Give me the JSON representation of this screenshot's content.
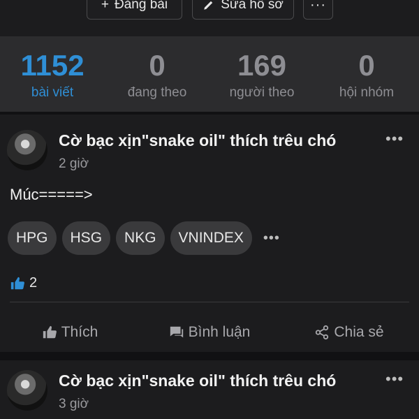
{
  "toolbar": {
    "post_label": "Đăng bài",
    "edit_profile_label": "Sửa hồ sơ",
    "more_label": "···"
  },
  "stats": [
    {
      "value": "1152",
      "label": "bài viết",
      "active": true
    },
    {
      "value": "0",
      "label": "đang theo",
      "active": false
    },
    {
      "value": "169",
      "label": "người theo",
      "active": false
    },
    {
      "value": "0",
      "label": "hội nhóm",
      "active": false
    }
  ],
  "posts": [
    {
      "author": "Cờ bạc xịn\"snake oil\" thích trêu chó",
      "time": "2 giờ",
      "content": "Múc=====>",
      "tags": [
        "HPG",
        "HSG",
        "NKG",
        "VNINDEX"
      ],
      "more_tags_label": "•••",
      "like_count": "2",
      "menu_label": "•••"
    },
    {
      "author": "Cờ bạc xịn\"snake oil\" thích trêu chó",
      "time": "3 giờ",
      "menu_label": "•••"
    }
  ],
  "actions": {
    "like_label": "Thích",
    "comment_label": "Bình luận",
    "share_label": "Chia sẻ"
  },
  "colors": {
    "background": "#1c1c1e",
    "stats_bg": "#2c2c2e",
    "accent": "#2f8fd6",
    "muted": "#8e8e93"
  }
}
